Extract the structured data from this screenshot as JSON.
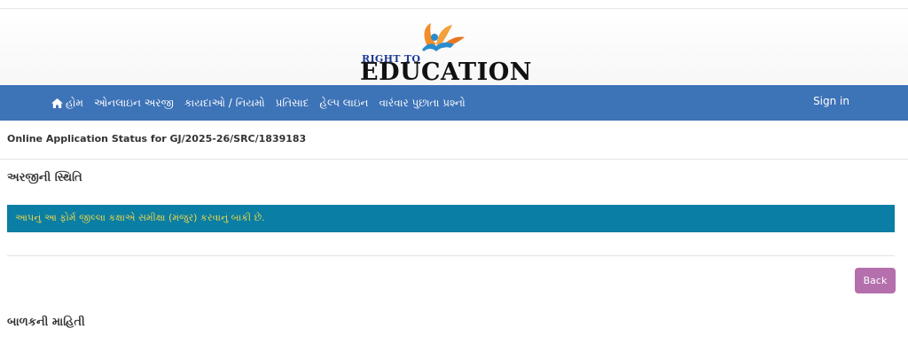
{
  "logo": {
    "line1": "RIGHT TO",
    "line2": "EDUCATION"
  },
  "nav": {
    "items": [
      {
        "label": "હોમ",
        "icon": "home-icon"
      },
      {
        "label": "ઓનલાઇન અરજી"
      },
      {
        "label": "કાયદાઓ / નિયમો"
      },
      {
        "label": "પ્રતિસાદ"
      },
      {
        "label": "હેલ્પ લાઇન"
      },
      {
        "label": "વારંવાર પુછાતા પ્રશ્નો"
      }
    ],
    "signin": "Sign in"
  },
  "page": {
    "status_title": "Online Application Status for GJ/2025-26/SRC/1839183",
    "application_status_heading": "અરજીની સ્થિતિ",
    "alert_message": "આપનું આ ફોર્મ જીલ્લા કક્ષાએ સમીક્ષા (મંજુર) કરવાનું બાકી છે.",
    "back_label": "Back",
    "child_info_heading": "બાળકની માહિતી"
  },
  "colors": {
    "navbar": "#3d73b7",
    "alert_bg": "#0a7ea4",
    "alert_text": "#f0d84a",
    "back_button": "#b56fad"
  }
}
